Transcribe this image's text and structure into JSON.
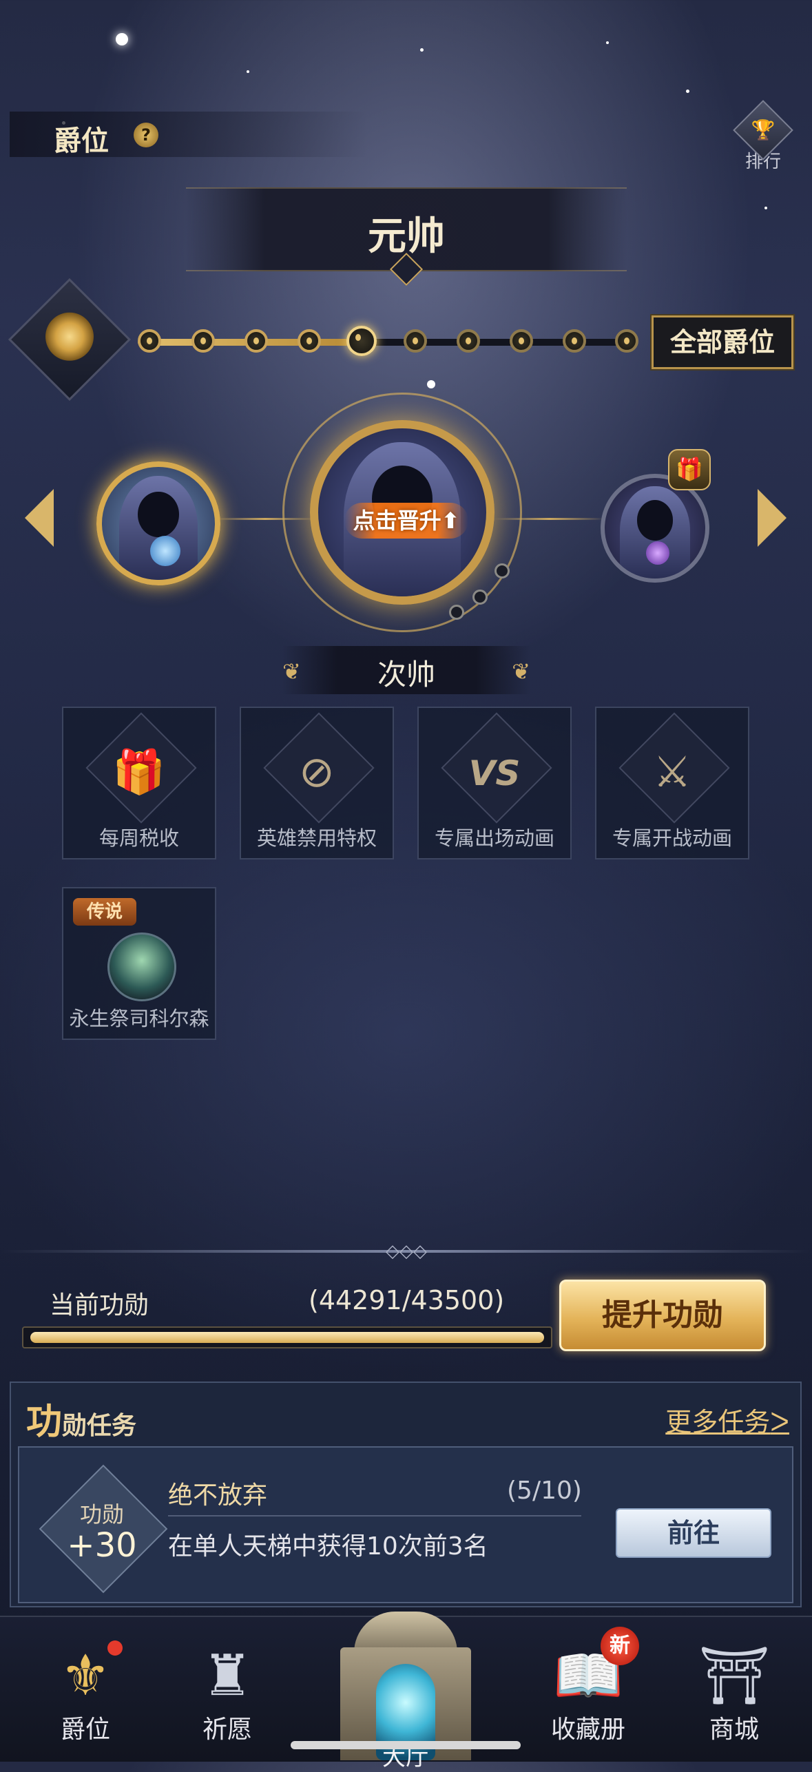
{
  "header": {
    "section_title": "爵位",
    "help_icon": "question-badge",
    "ranking_label": "排行"
  },
  "rank_banner": {
    "title": "元帅"
  },
  "progress_track": {
    "all_ranks_label": "全部爵位",
    "total_nodes": 10,
    "current_node": 5,
    "filled_fraction": 0.45
  },
  "carousel": {
    "promote_label": "点击晋升",
    "current_rank_name": "次帅"
  },
  "perks": [
    {
      "label": "每周税收",
      "icon": "gift-icon"
    },
    {
      "label": "英雄禁用特权",
      "icon": "hero-ban-icon"
    },
    {
      "label": "专属出场动画",
      "icon": "vs-icon"
    },
    {
      "label": "专属开战动画",
      "icon": "battle-icon"
    },
    {
      "label": "永生祭司科尔森",
      "badge": "传说",
      "icon": "hero-portrait"
    }
  ],
  "merit": {
    "label": "当前功勋",
    "value_text": "(44291/43500)",
    "current": 44291,
    "target": 43500,
    "boost_label": "提升功勋"
  },
  "tasks": {
    "title_big": "功",
    "title_rest": "勋任务",
    "more_label": "更多任务",
    "item": {
      "reward_label": "功勋",
      "reward_value": "+30",
      "name": "绝不放弃",
      "progress": "(5/10)",
      "description": "在单人天梯中获得10次前3名",
      "go_label": "前往"
    }
  },
  "nav": {
    "items": [
      {
        "label": "爵位",
        "active": true
      },
      {
        "label": "祈愿"
      },
      {
        "label": "大厅"
      },
      {
        "label": "收藏册",
        "badge": "新"
      },
      {
        "label": "商城"
      }
    ]
  },
  "colors": {
    "gold": "#d9b66a",
    "accent_orange": "#ff7814",
    "bg_dark": "#1b2138"
  }
}
